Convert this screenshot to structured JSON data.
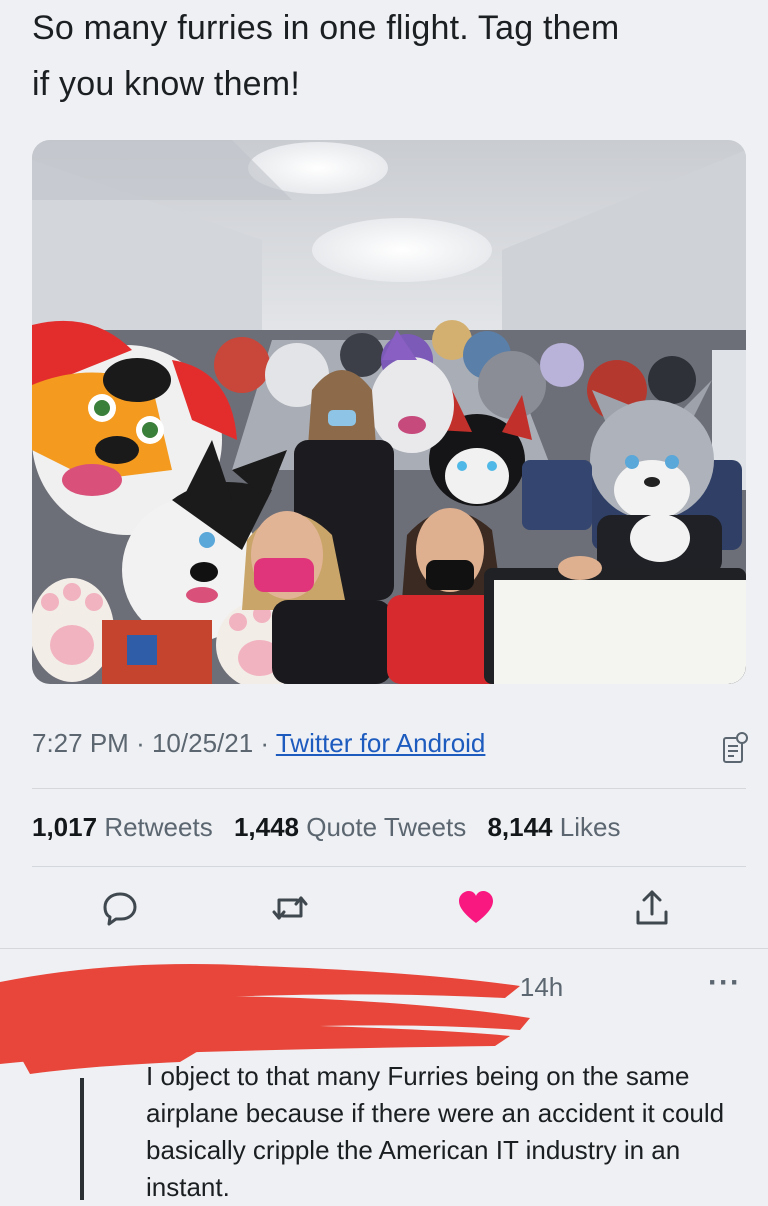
{
  "tweet": {
    "text": "So many furries in one flight. Tag them\nif you know them!",
    "time": "7:27 PM",
    "sep1": "·",
    "date": "10/25/21",
    "sep2": "·",
    "source": "Twitter for Android",
    "photo_icon": "analytics-icon"
  },
  "stats": {
    "retweets_count": "1,017",
    "retweets_label": "Retweets",
    "quotes_count": "1,448",
    "quotes_label": "Quote Tweets",
    "likes_count": "8,144",
    "likes_label": "Likes"
  },
  "actions": {
    "reply_icon": "reply-icon",
    "retweet_icon": "retweet-icon",
    "like_icon": "heart-icon",
    "like_color": "#f91880",
    "share_icon": "share-icon"
  },
  "reply": {
    "time": "· 14h",
    "more": "···",
    "text": "I object to that many Furries being on the same airplane because if there were an accident it could basically cripple the American IT industry in an instant.",
    "redaction_color": "#e8463a"
  }
}
